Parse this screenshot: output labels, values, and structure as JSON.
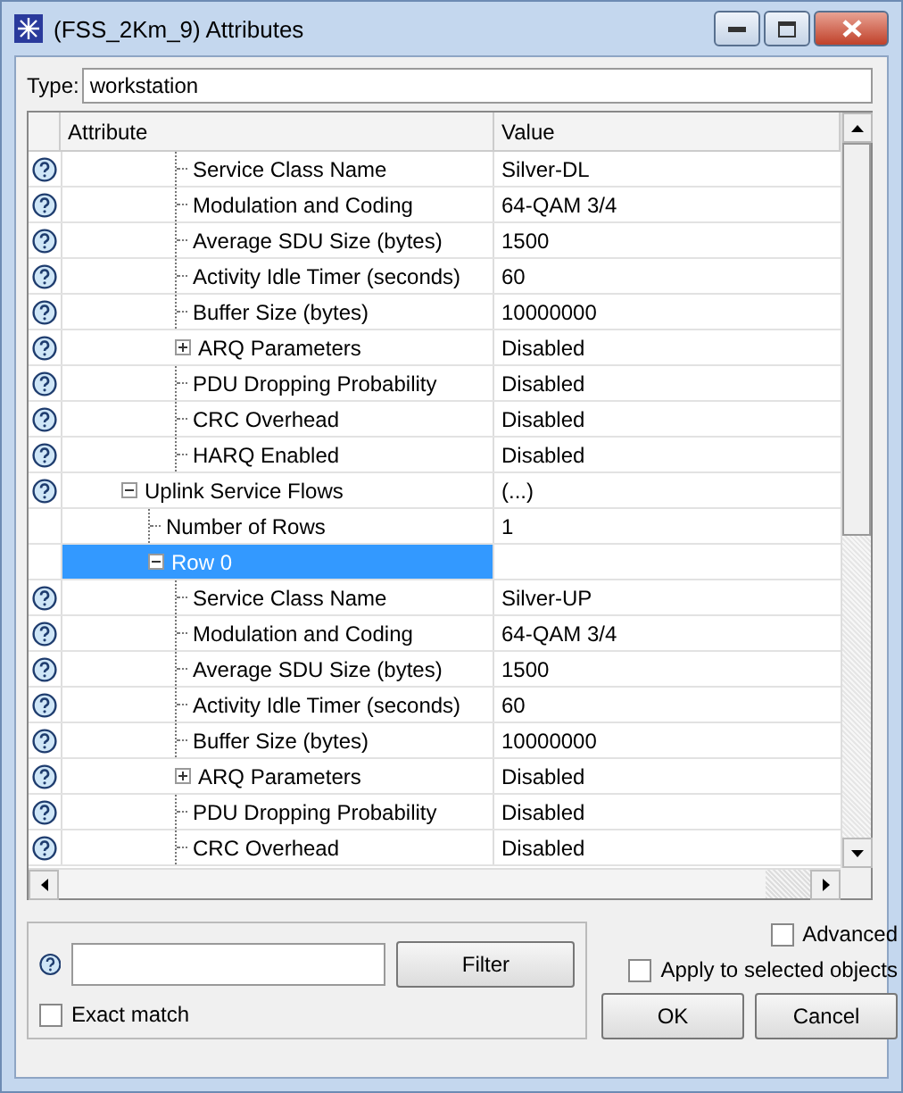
{
  "window": {
    "title": "(FSS_2Km_9) Attributes"
  },
  "type_field": {
    "label": "Type:",
    "value": "workstation"
  },
  "table": {
    "columns": [
      "Attribute",
      "Value"
    ],
    "tree": [
      {
        "children": [
          {
            "children": [
              {
                "label": "Service Class Name",
                "value": "Silver-DL",
                "help": true,
                "selected": false
              },
              {
                "label": "Modulation and Coding",
                "value": "64-QAM 3/4",
                "help": true,
                "selected": false
              },
              {
                "label": "Average SDU Size (bytes)",
                "value": "1500",
                "help": true,
                "selected": false
              },
              {
                "label": "Activity Idle Timer (seconds)",
                "value": "60",
                "help": true,
                "selected": false
              },
              {
                "label": "Buffer Size (bytes)",
                "value": "10000000",
                "help": true,
                "selected": false
              },
              {
                "label": "ARQ Parameters",
                "value": "Disabled",
                "help": true,
                "selected": false,
                "expanded": false
              },
              {
                "label": "PDU Dropping Probability",
                "value": "Disabled",
                "help": true,
                "selected": false
              },
              {
                "label": "CRC Overhead",
                "value": "Disabled",
                "help": true,
                "selected": false
              },
              {
                "label": "HARQ Enabled",
                "value": "Disabled",
                "help": true,
                "selected": false
              }
            ]
          }
        ]
      },
      {
        "label": "Uplink Service Flows",
        "value": "(...)",
        "help": true,
        "selected": false,
        "expanded": true,
        "children": [
          {
            "label": "Number of Rows",
            "value": "1",
            "help": false,
            "selected": false
          },
          {
            "label": "Row 0",
            "help": false,
            "selected": true,
            "expanded": true,
            "children": [
              {
                "label": "Service Class Name",
                "value": "Silver-UP",
                "help": true,
                "selected": false
              },
              {
                "label": "Modulation and Coding",
                "value": "64-QAM 3/4",
                "help": true,
                "selected": false
              },
              {
                "label": "Average SDU Size (bytes)",
                "value": "1500",
                "help": true,
                "selected": false
              },
              {
                "label": "Activity Idle Timer (seconds)",
                "value": "60",
                "help": true,
                "selected": false
              },
              {
                "label": "Buffer Size (bytes)",
                "value": "10000000",
                "help": true,
                "selected": false
              },
              {
                "label": "ARQ Parameters",
                "value": "Disabled",
                "help": true,
                "selected": false,
                "expanded": false
              },
              {
                "label": "PDU Dropping Probability",
                "value": "Disabled",
                "help": true,
                "selected": false
              },
              {
                "label": "CRC Overhead",
                "value": "Disabled",
                "help": true,
                "selected": false
              }
            ]
          }
        ]
      }
    ]
  },
  "filter": {
    "button": "Filter",
    "exact_match": {
      "label": "Exact match",
      "checked": false
    }
  },
  "advanced": {
    "label": "Advanced",
    "checked": false
  },
  "apply_selected": {
    "label": "Apply to selected objects",
    "checked": false
  },
  "buttons": [
    "OK",
    "Cancel"
  ]
}
